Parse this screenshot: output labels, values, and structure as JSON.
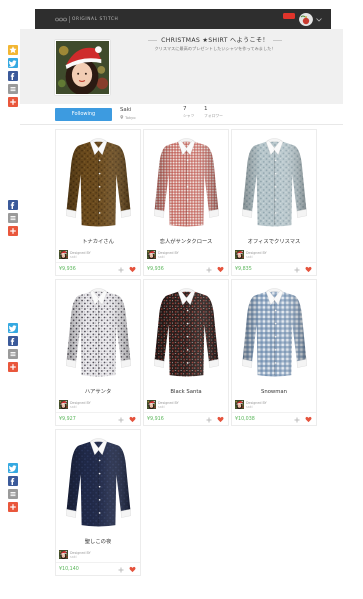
{
  "header": {
    "brand": "ORIGINAL STITCH",
    "logo_icon": "logo-icon",
    "user_icon": "avatar",
    "menu_icon": "chevron-down-icon"
  },
  "profile": {
    "title": "CHRISTMAS ★SHIRT へようこそ！",
    "subtitle": "クリスマスに最高のプレゼントしたいシャツを作ってみました！",
    "follow_button": "Following",
    "name": "Saki",
    "location": "Tokyo",
    "location_icon": "map-pin-icon",
    "stats": [
      {
        "value": "7",
        "label": "シャツ"
      },
      {
        "value": "1",
        "label": "フォロワー"
      }
    ]
  },
  "card_labels": {
    "designed_by": "Designed BY",
    "add_icon": "plus-icon",
    "like_icon": "heart-icon"
  },
  "products": [
    {
      "name": "トナカイさん",
      "designer": "saki",
      "price": "¥9,936",
      "shirt": {
        "base": "#6b4a1c",
        "accent": "#4a3110",
        "accent2": "#8a6a34",
        "pattern": "print"
      }
    },
    {
      "name": "恋人がサンタクロース",
      "designer": "saki",
      "price": "¥9,936",
      "shirt": {
        "base": "#f1e2de",
        "accent": "#b8443a",
        "accent2": "#b8443a",
        "pattern": "fine-check"
      }
    },
    {
      "name": "オフィスでクリスマス",
      "designer": "saki",
      "price": "¥9,835",
      "shirt": {
        "base": "#b9c8cd",
        "accent": "#8ea3ac",
        "accent2": "#dfe7ea",
        "pattern": "print"
      }
    },
    {
      "name": "ハアサンタ",
      "designer": "saki",
      "price": "¥9,927",
      "shirt": {
        "base": "#ecebee",
        "accent": "#3d3a45",
        "accent2": "#8e8a96",
        "pattern": "print"
      }
    },
    {
      "name": "Black Santa",
      "designer": "saki",
      "price": "¥9,916",
      "shirt": {
        "base": "#2a1d1b",
        "accent": "#a3423a",
        "accent2": "#e8e0d8",
        "pattern": "print"
      }
    },
    {
      "name": "Snowman",
      "designer": "saki",
      "price": "¥10,038",
      "shirt": {
        "base": "#e3e9f0",
        "accent": "#5f7fa6",
        "accent2": "#5f7fa6",
        "pattern": "check"
      }
    },
    {
      "name": "聖しこの夜",
      "designer": "saki",
      "price": "¥10,140",
      "shirt": {
        "base": "#1f2847",
        "accent": "#2d3960",
        "accent2": "#26304f",
        "pattern": "print"
      }
    }
  ],
  "share_bar": {
    "groups": [
      [
        "star-icon",
        "twitter-icon",
        "facebook-icon",
        "bookmark-icon",
        "google-plus-icon"
      ],
      [
        "facebook-icon",
        "bookmark-icon",
        "google-plus-icon"
      ],
      [
        "twitter-icon",
        "facebook-icon",
        "bookmark-icon",
        "google-plus-icon"
      ],
      [
        "twitter-icon",
        "facebook-icon",
        "bookmark-icon",
        "google-plus-icon"
      ]
    ],
    "colors": {
      "star-icon": "#f2b632",
      "twitter-icon": "#35a9e1",
      "facebook-icon": "#3b5a9a",
      "bookmark-icon": "#9a9a9a",
      "google-plus-icon": "#e9573c"
    }
  },
  "theme": {
    "accent": "#3d9be0",
    "price": "#5ab65a",
    "like": "#e5533d",
    "header": "#2e2e2e",
    "band": "#f0f0f0",
    "notification_badge": "#e0342b"
  }
}
